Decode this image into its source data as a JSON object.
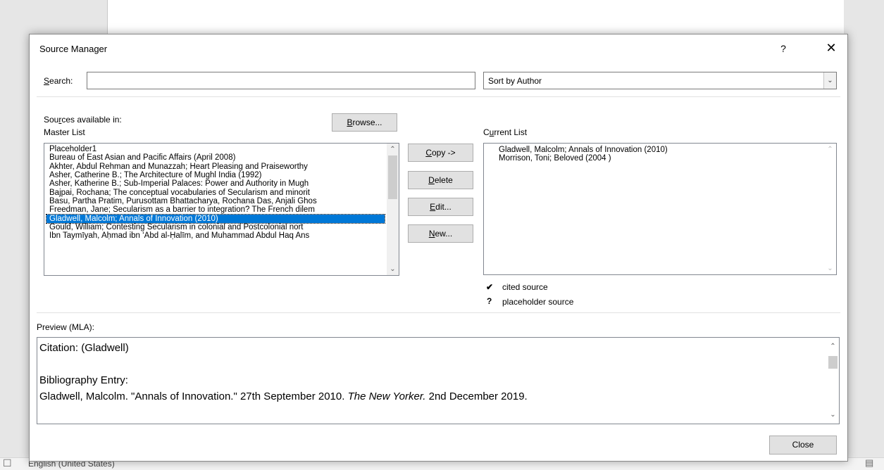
{
  "background": {
    "status_language": "English (United States)"
  },
  "dialog": {
    "title": "Source Manager",
    "help_label": "?",
    "close_x": "✕",
    "search": {
      "label": "Search:",
      "value": ""
    },
    "sort": {
      "value": "Sort by Author",
      "arrow_icon": "chevron-down-icon"
    },
    "sources_label": "Sources available in:",
    "master_list_label": "Master List",
    "browse_label": "Browse...",
    "current_list_label": "Current List",
    "buttons": {
      "copy": "Copy ->",
      "delete": "Delete",
      "edit": "Edit...",
      "new": "New...",
      "close": "Close"
    },
    "master_list": [
      "Placeholder1",
      "Bureau of East Asian and Pacific Affairs  (April 2008)",
      "Akhter, Abdul Rehman and Munazzah; Heart Pleasing and Praiseworthy",
      "Asher, Catherine B.; The Architecture of Mughl India (1992)",
      "Asher, Katherine B.; Sub-Imperial Palaces: Power and Authority in Mugh",
      "Bajpai, Rochana; The conceptual vocabularies of Secularism and minorit",
      "Basu, Partha Pratim, Purusottam Bhattacharya, Rochana Das, Anjali Ghos",
      "Freedman, Jane; Secularism as a barrier to integration? The French dilem",
      "Gladwell, Malcolm; Annals of Innovation (2010)",
      "Gould, William; Contesting Secularism in colonial and Postcolonial nort",
      "Ibn Taymīyah, Aḥmad ibn ʻAbd al-Ḥalīm, and Muhammad Abdul Haq Ans"
    ],
    "master_selected_index": 8,
    "master_scroll_fraction": 0.0,
    "current_list": [
      "Gladwell, Malcolm; Annals of Innovation (2010)",
      "Morrison, Toni; Beloved (2004 )"
    ],
    "legend": [
      {
        "symbol": "✔",
        "label": "cited source"
      },
      {
        "symbol": "?",
        "label": "placeholder source"
      }
    ],
    "preview": {
      "label": "Preview (MLA):",
      "citation": "Citation:  (Gladwell)",
      "bib_heading": "Bibliography Entry:",
      "bib_before": "Gladwell, Malcolm. \"Annals of Innovation.\" 27th September 2010. ",
      "bib_italic": "The New Yorker.",
      "bib_after": " 2nd December 2019."
    }
  }
}
